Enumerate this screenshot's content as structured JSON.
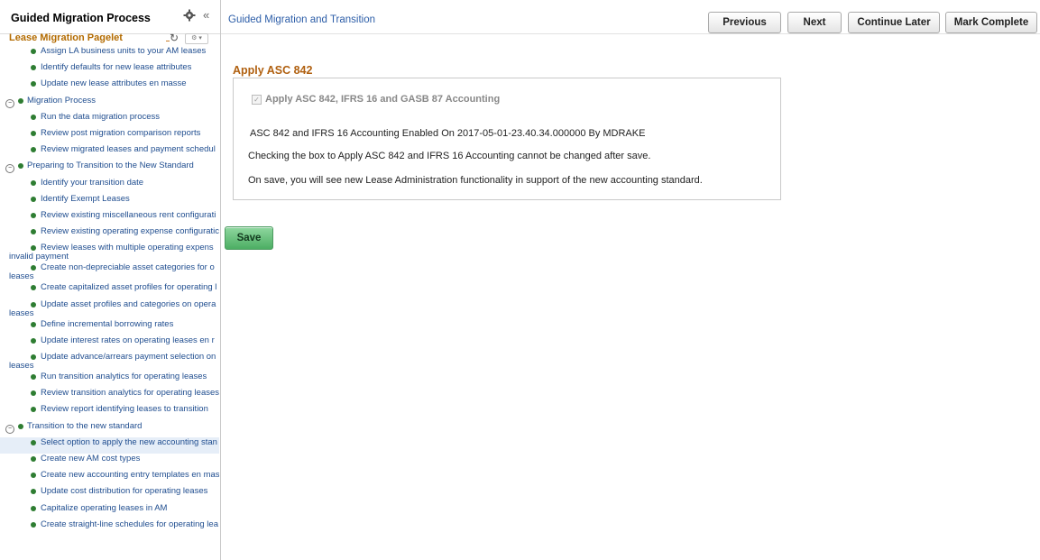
{
  "sidebar": {
    "title": "Guided Migration Process",
    "subtitle": "Lease Migration Pagelet",
    "collapse_glyph": "«",
    "refresh_glyph": "↻",
    "actions_glyph": "⚙ ▾",
    "items": [
      {
        "label": "Assign LA business units to your AM leases",
        "level": 2
      },
      {
        "label": "Identify defaults for new lease attributes",
        "level": 2
      },
      {
        "label": "Update new lease attributes en masse",
        "level": 2
      },
      {
        "label": "Migration Process",
        "level": 1,
        "toggle": "−"
      },
      {
        "label": "Run the data migration process",
        "level": 2
      },
      {
        "label": "Review post migration comparison reports",
        "level": 2
      },
      {
        "label": "Review migrated leases and payment schedul",
        "level": 2
      },
      {
        "label": "Preparing to Transition to the New Standard",
        "level": 1,
        "toggle": "−"
      },
      {
        "label": "Identify your transition date",
        "level": 2
      },
      {
        "label": "Identify Exempt Leases",
        "level": 2
      },
      {
        "label": "Review existing miscellaneous rent configurati",
        "level": 2
      },
      {
        "label": "Review existing operating expense configuratic",
        "level": 2
      },
      {
        "label": "Review leases with multiple operating expens",
        "label2": "invalid payment",
        "level": 2
      },
      {
        "label": "Create non-depreciable asset categories for o",
        "label2": "leases",
        "level": 2
      },
      {
        "label": "Create capitalized asset profiles for operating l",
        "level": 2
      },
      {
        "label": "Update asset profiles and categories on opera",
        "label2": "leases",
        "level": 2
      },
      {
        "label": "Define incremental borrowing rates",
        "level": 2
      },
      {
        "label": "Update interest rates on operating leases en r",
        "level": 2
      },
      {
        "label": "Update advance/arrears payment selection on",
        "label2": "leases",
        "level": 2
      },
      {
        "label": "Run transition analytics for operating leases",
        "level": 2
      },
      {
        "label": "Review transition analytics for operating leases",
        "level": 2
      },
      {
        "label": "Review report identifying leases to transition",
        "level": 2
      },
      {
        "label": "Transition to the new standard",
        "level": 1,
        "toggle": "−"
      },
      {
        "label": "Select option to apply the new accounting stan",
        "level": 2,
        "selected": true
      },
      {
        "label": "Create new AM cost types",
        "level": 2
      },
      {
        "label": "Create new accounting entry templates en mas",
        "level": 2
      },
      {
        "label": "Update cost distribution for operating leases",
        "level": 2
      },
      {
        "label": "Capitalize operating leases in AM",
        "level": 2
      },
      {
        "label": "Create straight-line schedules for operating lea",
        "level": 2
      }
    ]
  },
  "topbar": {
    "breadcrumb": "Guided Migration and Transition",
    "buttons": {
      "previous": "Previous",
      "next": "Next",
      "continue_later": "Continue Later",
      "mark_complete": "Mark Complete"
    }
  },
  "main": {
    "section_title": "Apply ASC 842",
    "checkbox_label": "Apply ASC 842, IFRS 16 and GASB 87 Accounting",
    "checkbox_checked": true,
    "enabled_text": "ASC 842 and IFRS 16 Accounting Enabled On 2017-05-01-23.40.34.000000 By MDRAKE",
    "warning_text": "Checking the box to Apply ASC 842 and IFRS 16 Accounting cannot be changed after save.",
    "info_text": "On save, you will see new Lease Administration functionality in support of the new accounting standard.",
    "save_label": "Save"
  },
  "colors": {
    "accent_orange": "#b06010",
    "link_blue": "#1f4d8f",
    "bullet_green": "#2e7d32",
    "save_green": "#4cae63"
  }
}
